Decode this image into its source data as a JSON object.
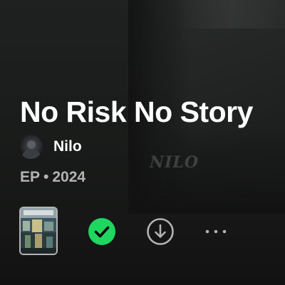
{
  "album": {
    "title": "No Risk No Story",
    "artist": "Nilo",
    "type": "EP",
    "separator": "•",
    "year": "2024"
  },
  "background_art": {
    "signature_text": "NILO"
  },
  "controls": {
    "saved_icon": "check-circle-icon",
    "download_icon": "download-circle-icon",
    "more_icon": "more-horizontal-icon"
  },
  "colors": {
    "accent": "#1ed760",
    "background": "#121212",
    "secondary_text": "#b3b3b3"
  }
}
